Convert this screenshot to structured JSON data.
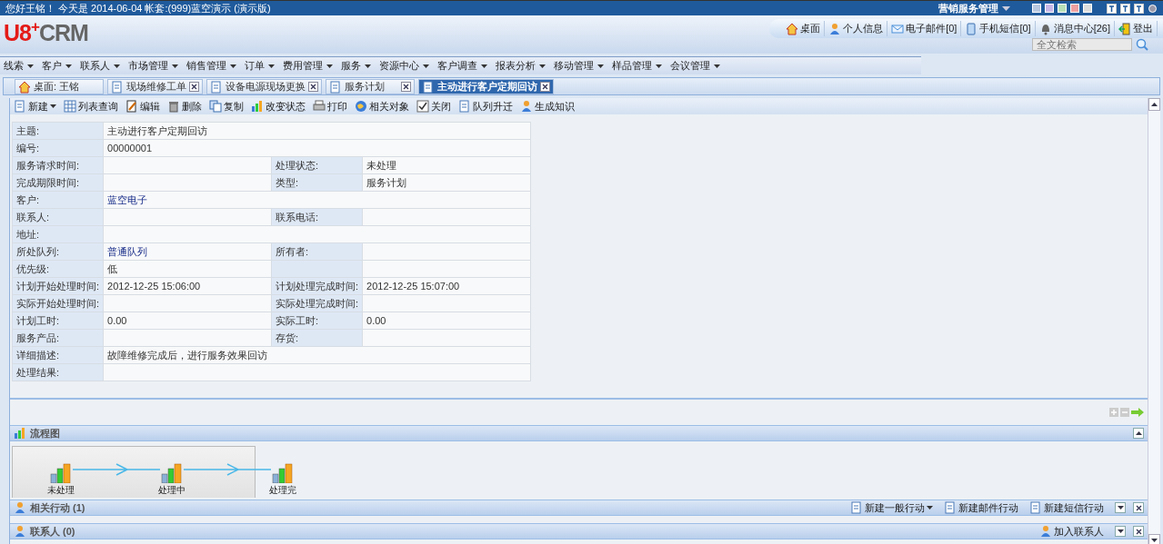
{
  "top_bar": {
    "greeting": "您好王铭！ 今天是 2014-06-04 帐套:(999)蓝空演示 (演示版)",
    "module": "营销服务管理"
  },
  "header": {
    "logo_main": "U8",
    "logo_plus": "+",
    "logo_rest": "CRM",
    "nav": [
      {
        "label": "桌面"
      },
      {
        "label": "个人信息"
      },
      {
        "label": "电子邮件[0]"
      },
      {
        "label": "手机短信[0]"
      },
      {
        "label": "消息中心[26]"
      },
      {
        "label": "登出"
      }
    ],
    "search": {
      "placeholder": "全文检索"
    }
  },
  "menu": [
    "线索",
    "客户",
    "联系人",
    "市场管理",
    "销售管理",
    "订单",
    "费用管理",
    "服务",
    "资源中心",
    "客户调查",
    "报表分析",
    "移动管理",
    "样品管理",
    "会议管理"
  ],
  "tabs": [
    {
      "label": "桌面: 王铭",
      "selected": false,
      "closable": false
    },
    {
      "label": "现场维修工单",
      "selected": false,
      "closable": true
    },
    {
      "label": "设备电源现场更换",
      "selected": false,
      "closable": true
    },
    {
      "label": "服务计划",
      "selected": false,
      "closable": true
    },
    {
      "label": "主动进行客户定期回访",
      "selected": true,
      "closable": true
    }
  ],
  "toolbar": [
    {
      "label": "新建",
      "dropdown": true
    },
    {
      "label": "列表查询",
      "dropdown": false
    },
    {
      "label": "编辑",
      "dropdown": false
    },
    {
      "label": "删除",
      "dropdown": false
    },
    {
      "label": "复制",
      "dropdown": false
    },
    {
      "label": "改变状态",
      "dropdown": false
    },
    {
      "label": "打印",
      "dropdown": false
    },
    {
      "label": "相关对象",
      "dropdown": false
    },
    {
      "label": "关闭",
      "dropdown": false
    },
    {
      "label": "队列升迁",
      "dropdown": false
    },
    {
      "label": "生成知识",
      "dropdown": false
    }
  ],
  "form": {
    "rows": [
      [
        {
          "label": "主题:",
          "value": "主动进行客户定期回访",
          "link": false
        }
      ],
      [
        {
          "label": "编号:",
          "value": "00000001",
          "link": false
        }
      ],
      [
        {
          "label": "服务请求时间:"
        },
        {
          "label": "处理状态:",
          "value": "未处理",
          "link": false
        }
      ],
      [
        {
          "label": "完成期限时间:"
        },
        {
          "label": "类型:",
          "value": "服务计划",
          "link": false
        }
      ],
      [
        {
          "label": "客户:",
          "value": "蓝空电子",
          "link": true
        }
      ],
      [
        {
          "label": "联系人:"
        },
        {
          "label": "联系电话:"
        }
      ],
      [
        {
          "label": "地址:"
        }
      ],
      [
        {
          "label": "所处队列:",
          "value": "普通队列",
          "link": true
        },
        {
          "label": "所有者:"
        }
      ],
      [
        {
          "label": "优先级:",
          "value": "低",
          "link": false
        },
        {}
      ],
      [
        {
          "label": "计划开始处理时间:",
          "value": "2012-12-25 15:06:00",
          "link": false
        },
        {
          "label": "计划处理完成时间:",
          "value": "2012-12-25 15:07:00",
          "link": false
        }
      ],
      [
        {
          "label": "实际开始处理时间:"
        },
        {
          "label": "实际处理完成时间:"
        }
      ],
      [
        {
          "label": "计划工时:",
          "value": "0.00",
          "link": false
        },
        {
          "label": "实际工时:",
          "value": "0.00",
          "link": false
        }
      ],
      [
        {
          "label": "服务产品:"
        },
        {
          "label": "存货:"
        }
      ],
      [
        {
          "label": "详细描述:",
          "value": "故障维修完成后，进行服务效果回访",
          "link": false
        }
      ],
      [
        {
          "label": "处理结果:"
        }
      ]
    ]
  },
  "sections": [
    {
      "title": "流程图",
      "kind": "flow",
      "expanded": true,
      "nodes": [
        {
          "label": "未处理"
        },
        {
          "label": "处理中"
        },
        {
          "label": "处理完"
        }
      ]
    },
    {
      "title": "相关行动 (1)",
      "kind": "list",
      "expanded": false,
      "actions": [
        {
          "label": "新建一般行动",
          "dropdown": true
        },
        {
          "label": "新建邮件行动",
          "dropdown": false
        },
        {
          "label": "新建短信行动",
          "dropdown": false
        }
      ]
    },
    {
      "title": "联系人 (0)",
      "kind": "list",
      "expanded": false,
      "actions": [
        {
          "label": "加入联系人",
          "dropdown": false
        }
      ]
    }
  ]
}
